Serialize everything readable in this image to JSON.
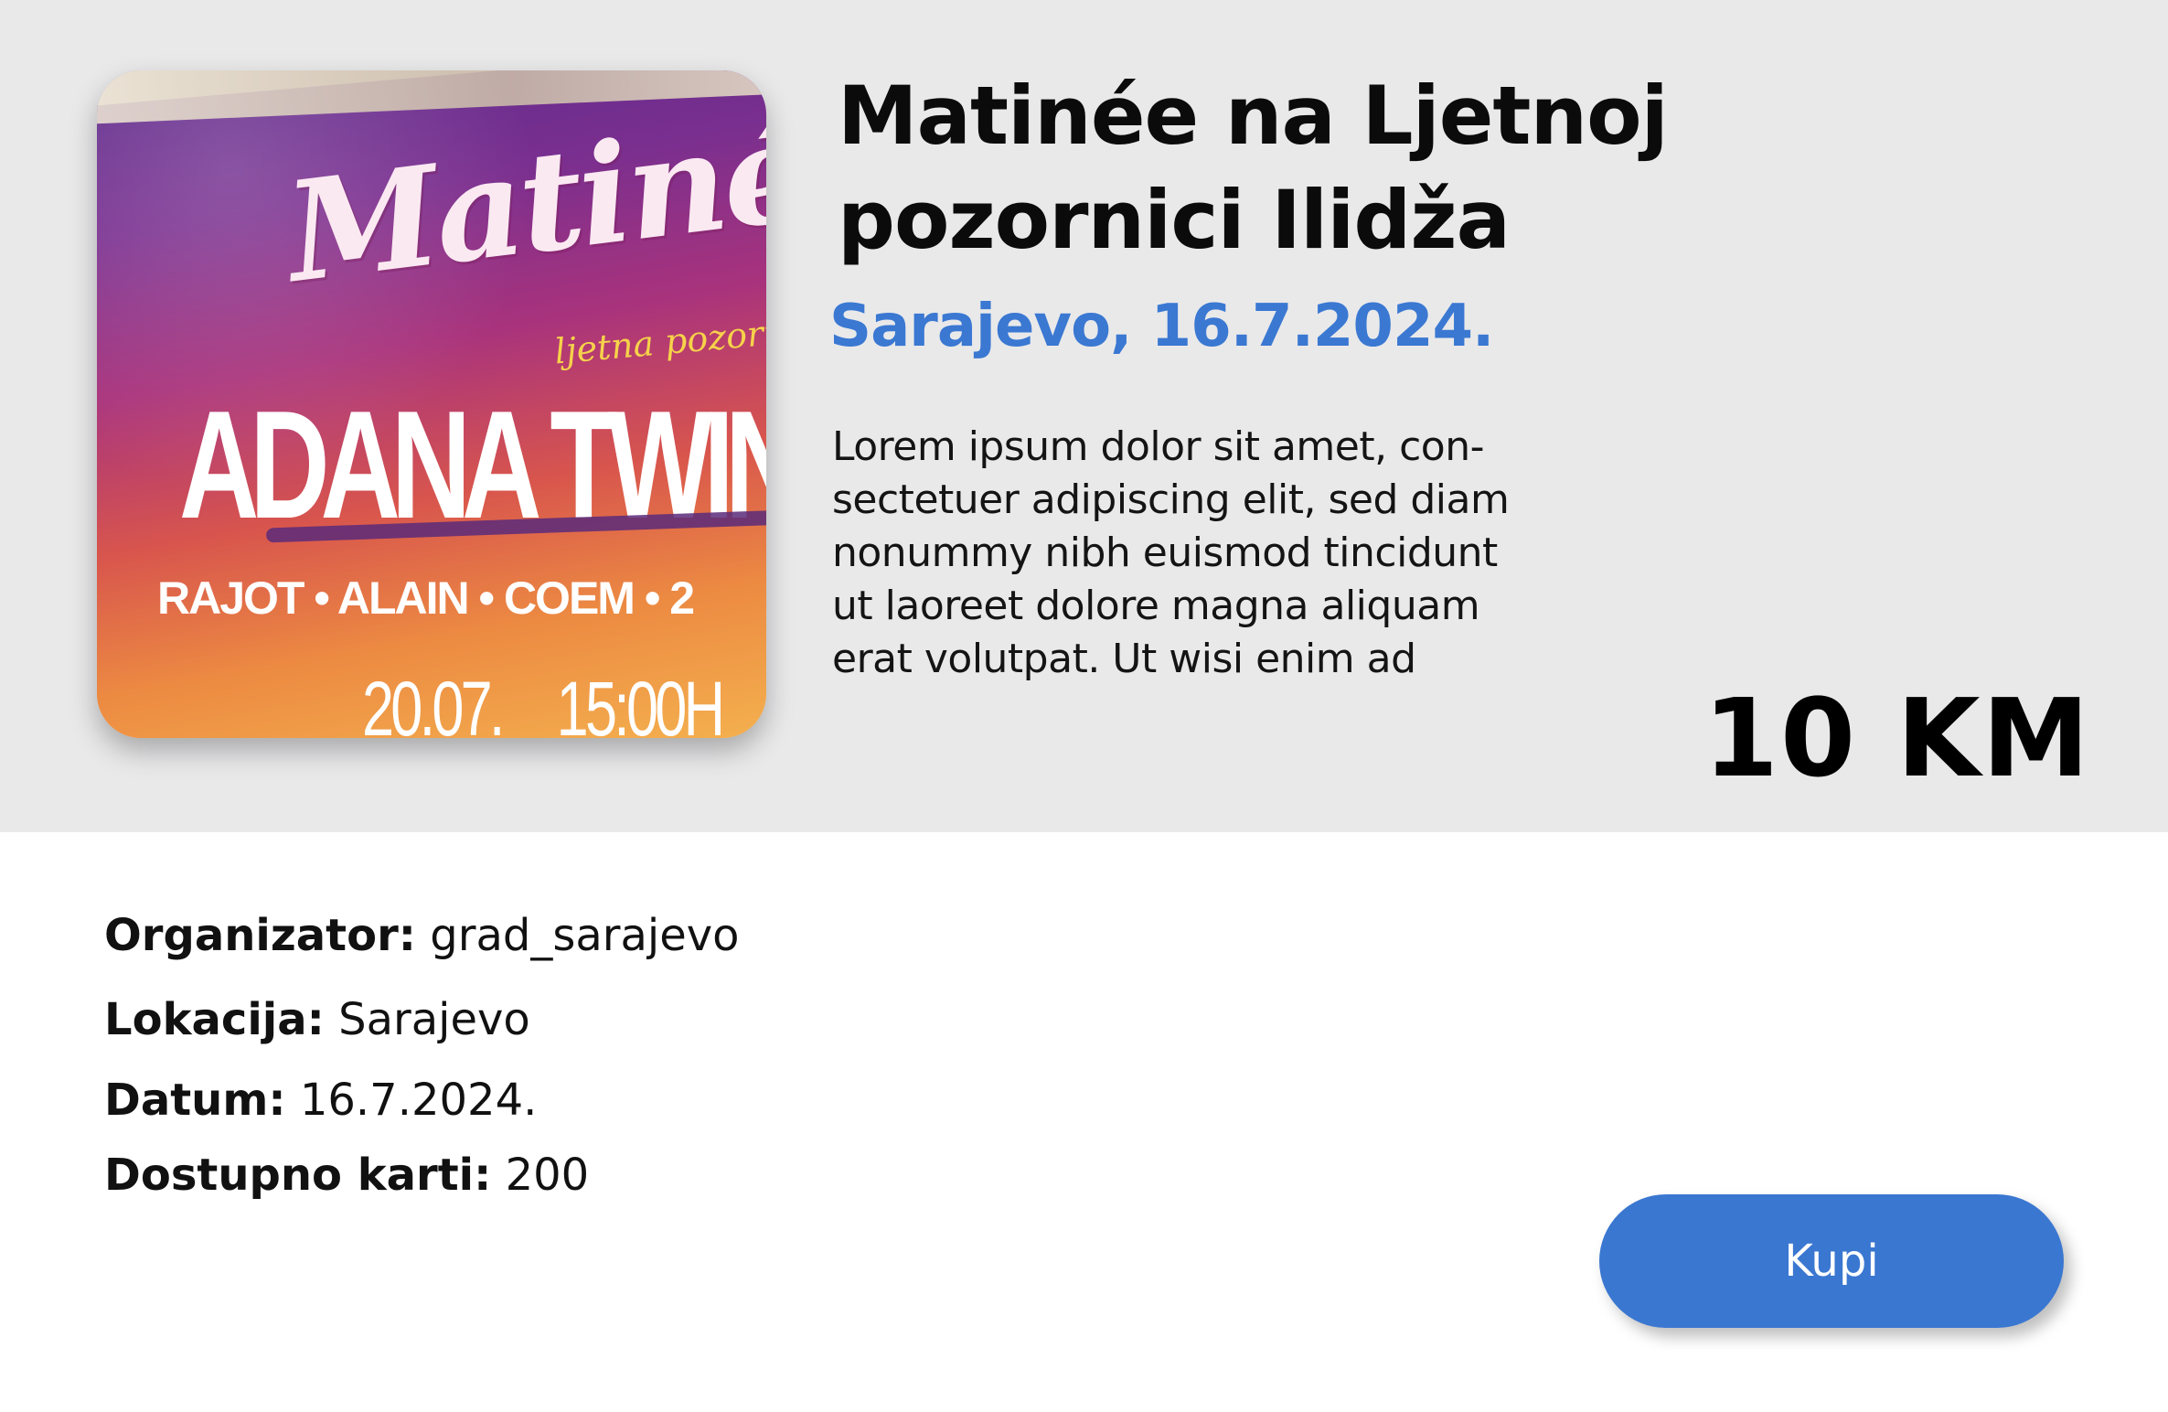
{
  "event": {
    "title": "Matinée na Ljetnoj pozornici Ilidža",
    "subtitle": "Sarajevo, 16.7.2024.",
    "description": "Lorem ipsum dolor sit amet, con-sectetuer adipiscing elit, sed diam nonummy nibh euismod tincidunt ut laoreet dolore magna aliquam erat volutpat. Ut wisi enim ad",
    "price": "10 KM"
  },
  "poster": {
    "script_text": "Matinée",
    "sub_text": "ljetna pozornica",
    "headline": "ADANA TWINS",
    "names": "RAJOT • ALAIN • COEM • 2",
    "date": "20.07.",
    "time": "15:00H"
  },
  "details": {
    "organizer_label": "Organizator:",
    "organizer_value": "grad_sarajevo",
    "location_label": "Lokacija:",
    "location_value": "Sarajevo",
    "date_label": "Datum:",
    "date_value": "16.7.2024.",
    "tickets_label": "Dostupno karti:",
    "tickets_value": "200"
  },
  "actions": {
    "buy_label": "Kupi"
  },
  "colors": {
    "accent": "#3a78d2",
    "header_bg": "#e9e9ea",
    "button": "#3a77d1"
  }
}
